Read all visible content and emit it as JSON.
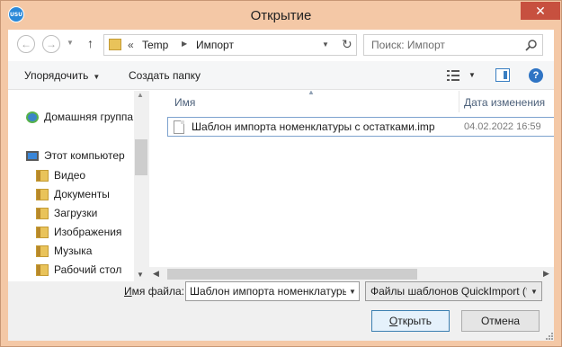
{
  "window": {
    "title": "Открытие",
    "app_icon_text": "USU",
    "close_glyph": "✕"
  },
  "navigation": {
    "back_glyph": "←",
    "forward_glyph": "→",
    "dropdown_glyph": "▼",
    "up_glyph": "↑",
    "address": {
      "prefix": "«",
      "crumbs": [
        "Temp",
        "Импорт"
      ],
      "separator": "▶",
      "dropdown_glyph": "▼",
      "refresh_glyph": "↻"
    },
    "search": {
      "placeholder": "Поиск: Импорт"
    }
  },
  "toolbar": {
    "organize_label": "Упорядочить",
    "organize_caret": "▼",
    "new_folder_label": "Создать папку",
    "view_dropdown_glyph": "▼",
    "help_glyph": "?"
  },
  "nav_pane": {
    "items": [
      {
        "label": "Домашняя группа",
        "icon": "homegroup-icon"
      },
      {
        "label": "Этот компьютер",
        "icon": "computer-icon"
      },
      {
        "label": "Видео",
        "icon": "folder-icon"
      },
      {
        "label": "Документы",
        "icon": "folder-icon"
      },
      {
        "label": "Загрузки",
        "icon": "folder-icon"
      },
      {
        "label": "Изображения",
        "icon": "folder-icon"
      },
      {
        "label": "Музыка",
        "icon": "folder-icon"
      },
      {
        "label": "Рабочий стол",
        "icon": "folder-icon"
      }
    ],
    "scroll_up_glyph": "▲",
    "scroll_down_glyph": "▼"
  },
  "file_list": {
    "columns": {
      "name": "Имя",
      "date": "Дата изменения",
      "sort_glyph": "▲"
    },
    "files": [
      {
        "name": "Шаблон импорта номенклатуры с остатками.imp",
        "date": "04.02.2022 16:59"
      }
    ],
    "scroll_left_glyph": "◀",
    "scroll_right_glyph": "▶"
  },
  "bottom": {
    "filename_label_underlined": "И",
    "filename_label_rest": "мя файла:",
    "filename_value": "Шаблон импорта номенклатуры с остатками.imp",
    "filename_dropdown_glyph": "▼",
    "filetype_value": "Файлы шаблонов QuickImport (*.imp)",
    "filetype_dropdown_glyph": "▼",
    "open_button_underlined": "О",
    "open_button_rest": "ткрыть",
    "cancel_button": "Отмена"
  }
}
